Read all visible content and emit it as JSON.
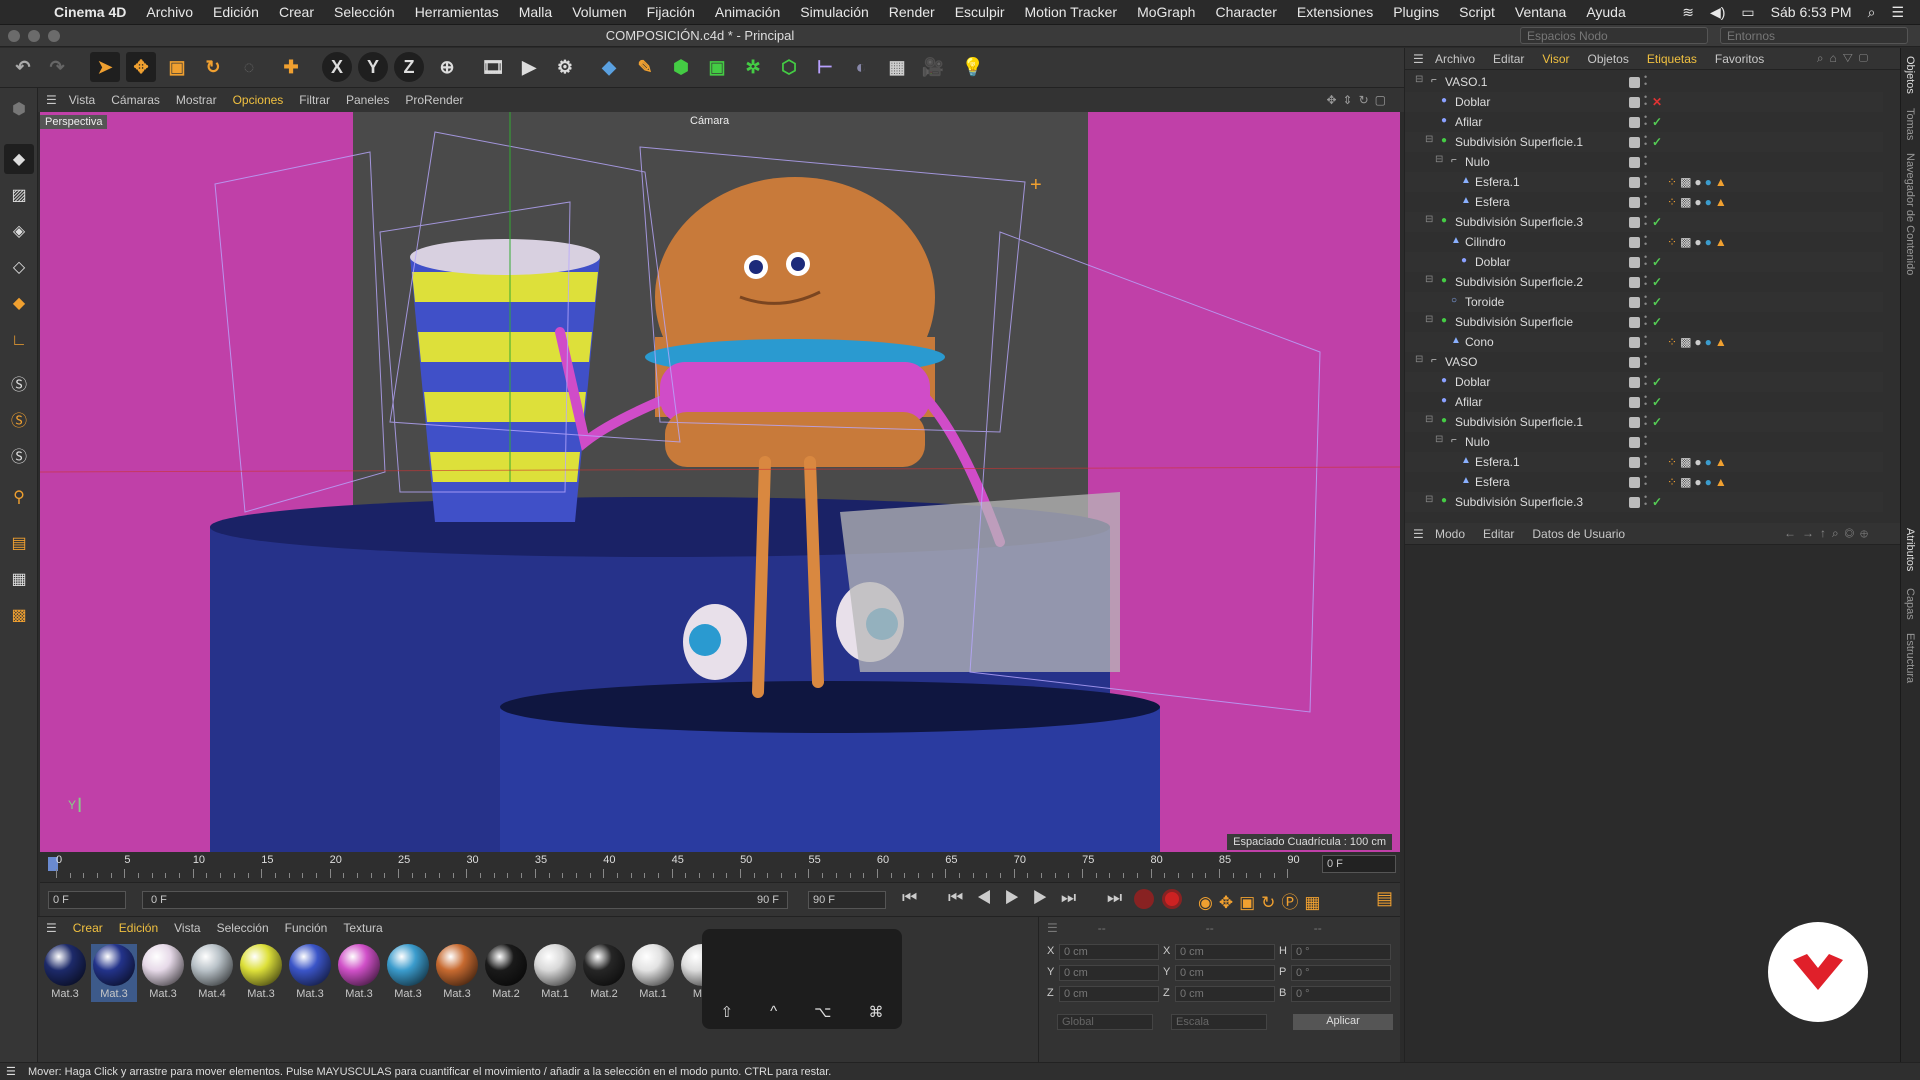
{
  "menubar": {
    "app": "Cinema 4D",
    "items": [
      "Archivo",
      "Edición",
      "Crear",
      "Selección",
      "Herramientas",
      "Malla",
      "Volumen",
      "Fijación",
      "Animación",
      "Simulación",
      "Render",
      "Esculpir",
      "Motion Tracker",
      "MoGraph",
      "Character",
      "Extensiones",
      "Plugins",
      "Script",
      "Ventana",
      "Ayuda"
    ],
    "clock": "Sáb 6:53 PM"
  },
  "window": {
    "title": "COMPOSICIÓN.c4d * - Principal",
    "node_space": "Espacios Nodo",
    "environments": "Entornos"
  },
  "viewport": {
    "menus": [
      "Vista",
      "Cámaras",
      "Mostrar",
      "Opciones",
      "Filtrar",
      "Paneles",
      "ProRender"
    ],
    "active_menu": "Opciones",
    "label": "Perspectiva",
    "camera": "Cámara",
    "grid_spacing": "Espaciado Cuadrícula : 100 cm"
  },
  "timeline": {
    "ticks": [
      "0",
      "5",
      "10",
      "15",
      "20",
      "25",
      "30",
      "35",
      "40",
      "45",
      "50",
      "55",
      "60",
      "65",
      "70",
      "75",
      "80",
      "85",
      "90"
    ],
    "current_frame": "0 F",
    "start": "0 F",
    "field2": "0 F",
    "end_left": "90 F",
    "end_right": "90 F"
  },
  "materials": {
    "menu": [
      "Crear",
      "Edición",
      "Vista",
      "Selección",
      "Función",
      "Textura"
    ],
    "items": [
      {
        "label": "Mat.3",
        "color": "#1d2a6a"
      },
      {
        "label": "Mat.3",
        "color": "#23338a"
      },
      {
        "label": "Mat.3",
        "color": "#e6d9e8"
      },
      {
        "label": "Mat.4",
        "color": "#b9c2c8"
      },
      {
        "label": "Mat.3",
        "color": "#dde03a"
      },
      {
        "label": "Mat.3",
        "color": "#3b55c8"
      },
      {
        "label": "Mat.3",
        "color": "#d050c8"
      },
      {
        "label": "Mat.3",
        "color": "#3b9ccd"
      },
      {
        "label": "Mat.3",
        "color": "#c76a30"
      },
      {
        "label": "Mat.2",
        "color": "#1a1a1a"
      },
      {
        "label": "Mat.1",
        "color": "#d8d8d8"
      },
      {
        "label": "Mat.2",
        "color": "#262626"
      },
      {
        "label": "Mat.1",
        "color": "#e2e2e2"
      },
      {
        "label": "Mat",
        "color": "#dcdcdc"
      }
    ],
    "selected_index": 1,
    "keys": [
      "⇧",
      "^",
      "⌥",
      "⌘"
    ]
  },
  "coords": {
    "rows": [
      {
        "a": "X",
        "va": "0 cm",
        "b": "X",
        "vb": "0 cm",
        "c": "H",
        "vc": "0 °"
      },
      {
        "a": "Y",
        "va": "0 cm",
        "b": "Y",
        "vb": "0 cm",
        "c": "P",
        "vc": "0 °"
      },
      {
        "a": "Z",
        "va": "0 cm",
        "b": "Z",
        "vb": "0 cm",
        "c": "B",
        "vc": "0 °"
      }
    ],
    "dash1": "--",
    "dash2": "--",
    "dash3": "--",
    "mode1": "Global",
    "mode2": "Escala",
    "apply": "Aplicar"
  },
  "objects": {
    "menu": [
      "Archivo",
      "Editar",
      "Visor",
      "Objetos",
      "Etiquetas",
      "Favoritos"
    ],
    "rows": [
      {
        "name": "VASO.1",
        "indent": 0,
        "type": "null",
        "check": "none"
      },
      {
        "name": "Doblar",
        "indent": 1,
        "type": "deform",
        "check": "x"
      },
      {
        "name": "Afilar",
        "indent": 1,
        "type": "deform",
        "check": "ok"
      },
      {
        "name": "Subdivisión Superficie.1",
        "indent": 1,
        "type": "subd",
        "check": "ok"
      },
      {
        "name": "Nulo",
        "indent": 2,
        "type": "null",
        "check": "none"
      },
      {
        "name": "Esfera.1",
        "indent": 3,
        "type": "poly",
        "check": "none",
        "tags": true
      },
      {
        "name": "Esfera",
        "indent": 3,
        "type": "poly",
        "check": "none",
        "tags": true
      },
      {
        "name": "Subdivisión Superficie.3",
        "indent": 1,
        "type": "subd",
        "check": "ok"
      },
      {
        "name": "Cilindro",
        "indent": 2,
        "type": "poly",
        "check": "none",
        "tags": true
      },
      {
        "name": "Doblar",
        "indent": 3,
        "type": "deform",
        "check": "ok"
      },
      {
        "name": "Subdivisión Superficie.2",
        "indent": 1,
        "type": "subd",
        "check": "ok"
      },
      {
        "name": "Toroide",
        "indent": 2,
        "type": "torus",
        "check": "ok"
      },
      {
        "name": "Subdivisión Superficie",
        "indent": 1,
        "type": "subd",
        "check": "ok"
      },
      {
        "name": "Cono",
        "indent": 2,
        "type": "poly",
        "check": "none",
        "tags": true
      },
      {
        "name": "VASO",
        "indent": 0,
        "type": "null",
        "check": "none"
      },
      {
        "name": "Doblar",
        "indent": 1,
        "type": "deform",
        "check": "ok"
      },
      {
        "name": "Afilar",
        "indent": 1,
        "type": "deform",
        "check": "ok"
      },
      {
        "name": "Subdivisión Superficie.1",
        "indent": 1,
        "type": "subd",
        "check": "ok"
      },
      {
        "name": "Nulo",
        "indent": 2,
        "type": "null",
        "check": "none"
      },
      {
        "name": "Esfera.1",
        "indent": 3,
        "type": "poly",
        "check": "none",
        "tags": true
      },
      {
        "name": "Esfera",
        "indent": 3,
        "type": "poly",
        "check": "none",
        "tags": true
      },
      {
        "name": "Subdivisión Superficie.3",
        "indent": 1,
        "type": "subd",
        "check": "ok"
      }
    ]
  },
  "attributes": {
    "menu": [
      "Modo",
      "Editar",
      "Datos de Usuario"
    ]
  },
  "side_tabs": [
    "Objetos",
    "Tomas",
    "Navegador de Contenido",
    "Atributos",
    "Capas",
    "Estructura"
  ],
  "status": "Mover: Haga Click y arrastre para mover elementos. Pulse MAYUSCULAS para cuantificar el movimiento / añadir a la selección en el modo punto. CTRL para restar.",
  "colors": {
    "accent": "#f0a030",
    "active_menu": "#f0c040",
    "bg_magenta": "#c040a8"
  }
}
